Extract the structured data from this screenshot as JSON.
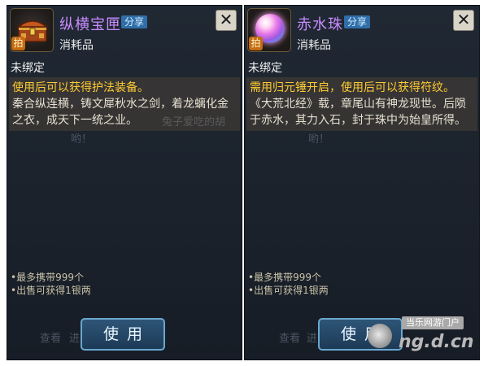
{
  "panels": [
    {
      "item_name": "纵横宝匣",
      "share_label": "分享",
      "item_type": "消耗品",
      "tag": "拍",
      "close_label": "✕",
      "bind_status": "未绑定",
      "desc_head": "使用后可以获得护法装备。",
      "desc_body": "秦合纵连横，铸文犀秋水之剑，着龙螭化金之衣，成天下一统之业。",
      "bullets": [
        "•最多携带999个",
        "•出售可获得1银两"
      ],
      "use_label": "使用",
      "background_text": [
        "兔子爱吃的胡",
        "哟！",
        "查看",
        "进"
      ]
    },
    {
      "item_name": "赤水珠",
      "share_label": "分享",
      "item_type": "消耗品",
      "tag": "拍",
      "close_label": "✕",
      "bind_status": "未绑定",
      "desc_head": "需用归元锤开启，使用后可以获得符纹。",
      "desc_body": "《大荒北经》载，章尾山有神龙现世。后陨于赤水，其力入石，封于珠中为始皇所得。",
      "bullets": [
        "•最多携带999个",
        "•出售可获得1银两"
      ],
      "use_label": "使用",
      "background_text": [
        "哟！",
        "查看",
        "进"
      ]
    }
  ],
  "watermark": {
    "site_label": "当乐网游门户",
    "url": "ng.d.cn"
  },
  "colors": {
    "item_name": "#c88cff",
    "desc_head": "#ffcc33",
    "share": "#2f6ea8",
    "use_button_border": "#6aa7cf"
  }
}
